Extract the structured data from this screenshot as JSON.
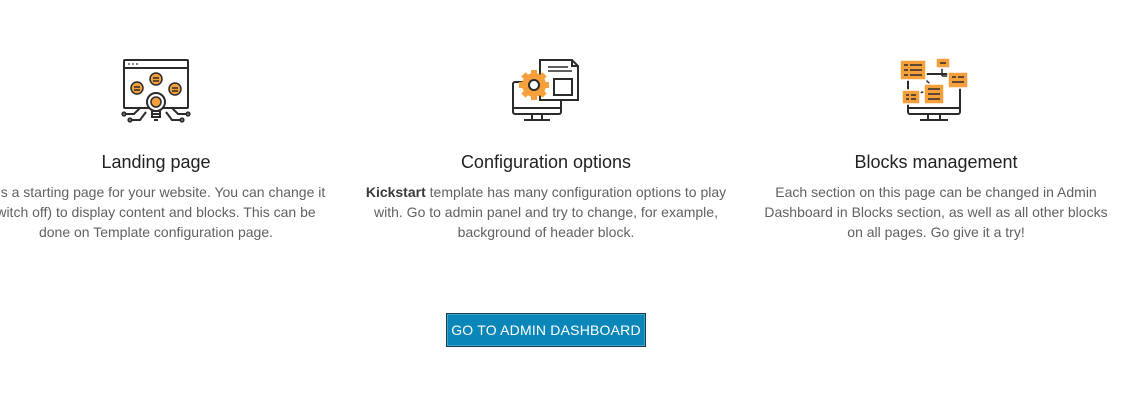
{
  "features": [
    {
      "icon": "idea-network-icon",
      "title": "Landing page",
      "desc_lines": [
        "s is a starting page for your website. You can change it",
        "witch off) to display content and blocks. This can be",
        "done on Template configuration page."
      ]
    },
    {
      "icon": "gear-document-monitor-icon",
      "title": "Configuration options",
      "desc_bold": "Kickstart",
      "desc_lines": [
        " template has many configuration options to play",
        "with. Go to admin panel and try to change, for example,",
        "background of header block."
      ]
    },
    {
      "icon": "blocks-monitor-icon",
      "title": "Blocks management",
      "desc_lines": [
        "Each section on this page can be changed in Admin",
        "Dashboard in Blocks section, as well as all other blocks",
        "on all pages. Go give it a try!"
      ]
    }
  ],
  "cta": {
    "label": "GO TO ADMIN DASHBOARD"
  },
  "colors": {
    "accent": "#f5a03c",
    "button": "#0a87b8",
    "icon_stroke": "#2b2b2b"
  }
}
